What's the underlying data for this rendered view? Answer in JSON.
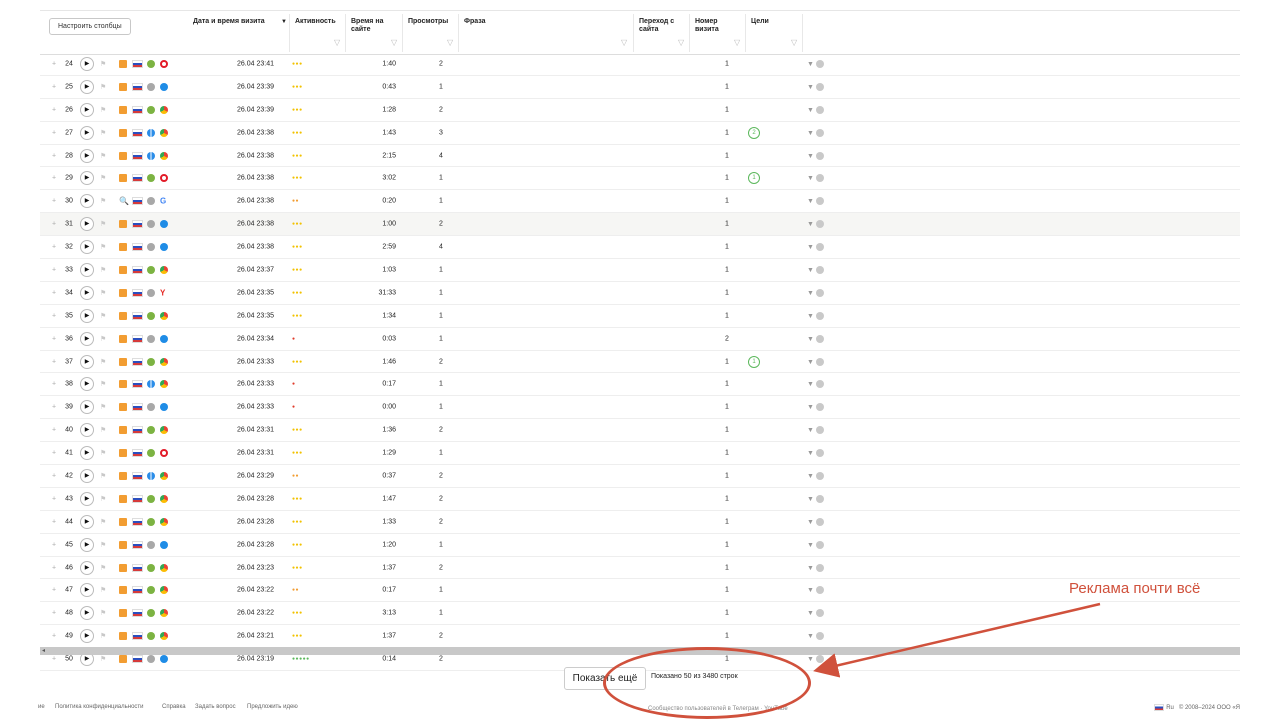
{
  "header": {
    "configure_button": "Настроить столбцы",
    "sort_arrow": "▼",
    "filter_glyph": "▽",
    "columns": {
      "datetime": "Дата и время визита",
      "activity": "Активность",
      "time_on_site_1": "Время на",
      "time_on_site_2": "сайте",
      "views": "Просмотры",
      "phrase": "Фраза",
      "transition_1": "Переход с",
      "transition_2": "сайта",
      "visit_number_1": "Номер",
      "visit_number_2": "визита",
      "goals": "Цели"
    }
  },
  "glyphs": {
    "plus": "+",
    "play": "▶",
    "flag": "⚑",
    "filter": "▼",
    "search": "🔍",
    "yandex": "Y",
    "google": "G"
  },
  "rows": [
    {
      "num": "24",
      "date": "26.04 23:41",
      "act": 3,
      "dur": "1:40",
      "pv": "2",
      "vn": "1",
      "goal": "",
      "os": "android",
      "br": "opera"
    },
    {
      "num": "25",
      "date": "26.04 23:39",
      "act": 3,
      "dur": "0:43",
      "pv": "1",
      "vn": "1",
      "goal": "",
      "os": "apple",
      "br": "safari"
    },
    {
      "num": "26",
      "date": "26.04 23:39",
      "act": 3,
      "dur": "1:28",
      "pv": "2",
      "vn": "1",
      "goal": "",
      "os": "android",
      "br": "chrome"
    },
    {
      "num": "27",
      "date": "26.04 23:38",
      "act": 3,
      "dur": "1:43",
      "pv": "3",
      "vn": "1",
      "goal": "2",
      "os": "win",
      "br": "chrome"
    },
    {
      "num": "28",
      "date": "26.04 23:38",
      "act": 3,
      "dur": "2:15",
      "pv": "4",
      "vn": "1",
      "goal": "",
      "os": "win",
      "br": "chrome"
    },
    {
      "num": "29",
      "date": "26.04 23:38",
      "act": 3,
      "dur": "3:02",
      "pv": "1",
      "vn": "1",
      "goal": "1",
      "os": "android",
      "br": "opera"
    },
    {
      "num": "30",
      "date": "26.04 23:38",
      "act": 2,
      "dur": "0:20",
      "pv": "1",
      "vn": "1",
      "goal": "",
      "os": "apple",
      "br": "google",
      "src": "search"
    },
    {
      "num": "31",
      "date": "26.04 23:38",
      "act": 3,
      "dur": "1:00",
      "pv": "2",
      "vn": "1",
      "goal": "",
      "os": "apple",
      "br": "safari",
      "hl": true
    },
    {
      "num": "32",
      "date": "26.04 23:38",
      "act": 3,
      "dur": "2:59",
      "pv": "4",
      "vn": "1",
      "goal": "",
      "os": "apple",
      "br": "safari"
    },
    {
      "num": "33",
      "date": "26.04 23:37",
      "act": 3,
      "dur": "1:03",
      "pv": "1",
      "vn": "1",
      "goal": "",
      "os": "android",
      "br": "chrome"
    },
    {
      "num": "34",
      "date": "26.04 23:35",
      "act": 3,
      "dur": "31:33",
      "pv": "1",
      "vn": "1",
      "goal": "",
      "os": "apple",
      "br": "yandex"
    },
    {
      "num": "35",
      "date": "26.04 23:35",
      "act": 3,
      "dur": "1:34",
      "pv": "1",
      "vn": "1",
      "goal": "",
      "os": "android",
      "br": "chrome"
    },
    {
      "num": "36",
      "date": "26.04 23:34",
      "act": 1,
      "dur": "0:03",
      "pv": "1",
      "vn": "2",
      "goal": "",
      "os": "apple",
      "br": "safari"
    },
    {
      "num": "37",
      "date": "26.04 23:33",
      "act": 3,
      "dur": "1:46",
      "pv": "2",
      "vn": "1",
      "goal": "1",
      "os": "android",
      "br": "chrome"
    },
    {
      "num": "38",
      "date": "26.04 23:33",
      "act": 1,
      "dur": "0:17",
      "pv": "1",
      "vn": "1",
      "goal": "",
      "os": "win",
      "br": "chrome"
    },
    {
      "num": "39",
      "date": "26.04 23:33",
      "act": 1,
      "dur": "0:00",
      "pv": "1",
      "vn": "1",
      "goal": "",
      "os": "apple",
      "br": "safari"
    },
    {
      "num": "40",
      "date": "26.04 23:31",
      "act": 3,
      "dur": "1:36",
      "pv": "2",
      "vn": "1",
      "goal": "",
      "os": "android",
      "br": "chrome"
    },
    {
      "num": "41",
      "date": "26.04 23:31",
      "act": 3,
      "dur": "1:29",
      "pv": "1",
      "vn": "1",
      "goal": "",
      "os": "android",
      "br": "opera"
    },
    {
      "num": "42",
      "date": "26.04 23:29",
      "act": 2,
      "dur": "0:37",
      "pv": "2",
      "vn": "1",
      "goal": "",
      "os": "win",
      "br": "chrome"
    },
    {
      "num": "43",
      "date": "26.04 23:28",
      "act": 3,
      "dur": "1:47",
      "pv": "2",
      "vn": "1",
      "goal": "",
      "os": "android",
      "br": "chrome"
    },
    {
      "num": "44",
      "date": "26.04 23:28",
      "act": 3,
      "dur": "1:33",
      "pv": "2",
      "vn": "1",
      "goal": "",
      "os": "android",
      "br": "chrome"
    },
    {
      "num": "45",
      "date": "26.04 23:28",
      "act": 3,
      "dur": "1:20",
      "pv": "1",
      "vn": "1",
      "goal": "",
      "os": "apple",
      "br": "safari"
    },
    {
      "num": "46",
      "date": "26.04 23:23",
      "act": 3,
      "dur": "1:37",
      "pv": "2",
      "vn": "1",
      "goal": "",
      "os": "android",
      "br": "chrome"
    },
    {
      "num": "47",
      "date": "26.04 23:22",
      "act": 2,
      "dur": "0:17",
      "pv": "1",
      "vn": "1",
      "goal": "",
      "os": "android",
      "br": "chrome"
    },
    {
      "num": "48",
      "date": "26.04 23:22",
      "act": 3,
      "dur": "3:13",
      "pv": "1",
      "vn": "1",
      "goal": "",
      "os": "android",
      "br": "chrome"
    },
    {
      "num": "49",
      "date": "26.04 23:21",
      "act": 3,
      "dur": "1:37",
      "pv": "2",
      "vn": "1",
      "goal": "",
      "os": "android",
      "br": "chrome"
    },
    {
      "num": "50",
      "date": "26.04 23:19",
      "act": 5,
      "dur": "0:14",
      "pv": "2",
      "vn": "1",
      "goal": "",
      "os": "apple",
      "br": "safari"
    }
  ],
  "colors": {
    "act_high": "#f2c200",
    "act_mid": "#f29d32",
    "act_low": "#e03b2a",
    "act_full": "#5cb85c",
    "accent_annot": "#d0513c"
  },
  "pager": {
    "show_more": "Показать ещё",
    "shown_text": "Показано 50 из 3480 строк"
  },
  "annotation": {
    "text": "Реклама  почти всё"
  },
  "footer": {
    "links": [
      "ие",
      "Политика конфиденциальности",
      "Справка",
      "Задать вопрос",
      "Предложить идею"
    ],
    "lang": "Ru",
    "copyright": "© 2008–2024 ООО «Я",
    "community": "Сообщество пользователей в Телеграм · YouTube"
  }
}
